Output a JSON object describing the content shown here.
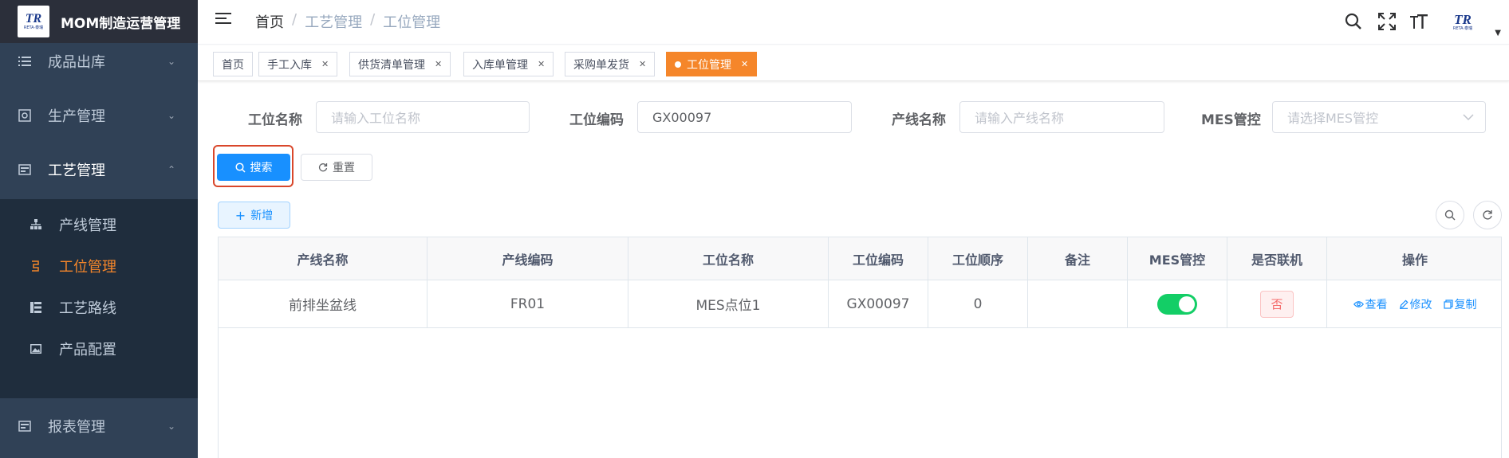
{
  "app": {
    "title": "MOM制造运营管理",
    "logo_text": "TR",
    "logo_sub": "RETA·泰瑞"
  },
  "sidebar": {
    "items": [
      {
        "label": "成品出库",
        "icon": "list-icon"
      },
      {
        "label": "生产管理",
        "icon": "production-icon"
      },
      {
        "label": "工艺管理",
        "icon": "process-icon"
      },
      {
        "label": "报表管理",
        "icon": "report-icon"
      }
    ],
    "subitems": [
      {
        "label": "产线管理",
        "icon": "org-tree-icon"
      },
      {
        "label": "工位管理",
        "icon": "station-icon",
        "active": true
      },
      {
        "label": "工艺路线",
        "icon": "route-icon"
      },
      {
        "label": "产品配置",
        "icon": "image-icon"
      }
    ]
  },
  "header": {
    "breadcrumb": [
      "首页",
      "工艺管理",
      "工位管理"
    ]
  },
  "tags": [
    {
      "label": "首页"
    },
    {
      "label": "手工入库"
    },
    {
      "label": "供货清单管理"
    },
    {
      "label": "入库单管理"
    },
    {
      "label": "采购单发货"
    },
    {
      "label": "工位管理",
      "active": true
    }
  ],
  "search": {
    "station_name_label": "工位名称",
    "station_name_placeholder": "请输入工位名称",
    "station_code_label": "工位编码",
    "station_code_value": "GX00097",
    "line_name_label": "产线名称",
    "line_name_placeholder": "请输入产线名称",
    "mes_label": "MES管控",
    "mes_placeholder": "请选择MES管控",
    "search_button": "搜索",
    "reset_button": "重置",
    "add_button": "新增"
  },
  "table": {
    "headers": [
      "产线名称",
      "产线编码",
      "工位名称",
      "工位编码",
      "工位顺序",
      "备注",
      "MES管控",
      "是否联机",
      "操作"
    ],
    "rows": [
      {
        "line_name": "前排坐盆线",
        "line_code": "FR01",
        "station_name": "MES点位1",
        "station_code": "GX00097",
        "order": "0",
        "remark": "",
        "mes_control": true,
        "online": "否"
      }
    ],
    "actions": {
      "view": "查看",
      "edit": "修改",
      "copy": "复制"
    }
  },
  "colors": {
    "accent": "#1890ff",
    "active_orange": "#f5862a",
    "sidebar_bg": "#304156",
    "toggle_on": "#13ce66",
    "highlight_border": "#d9472b"
  }
}
